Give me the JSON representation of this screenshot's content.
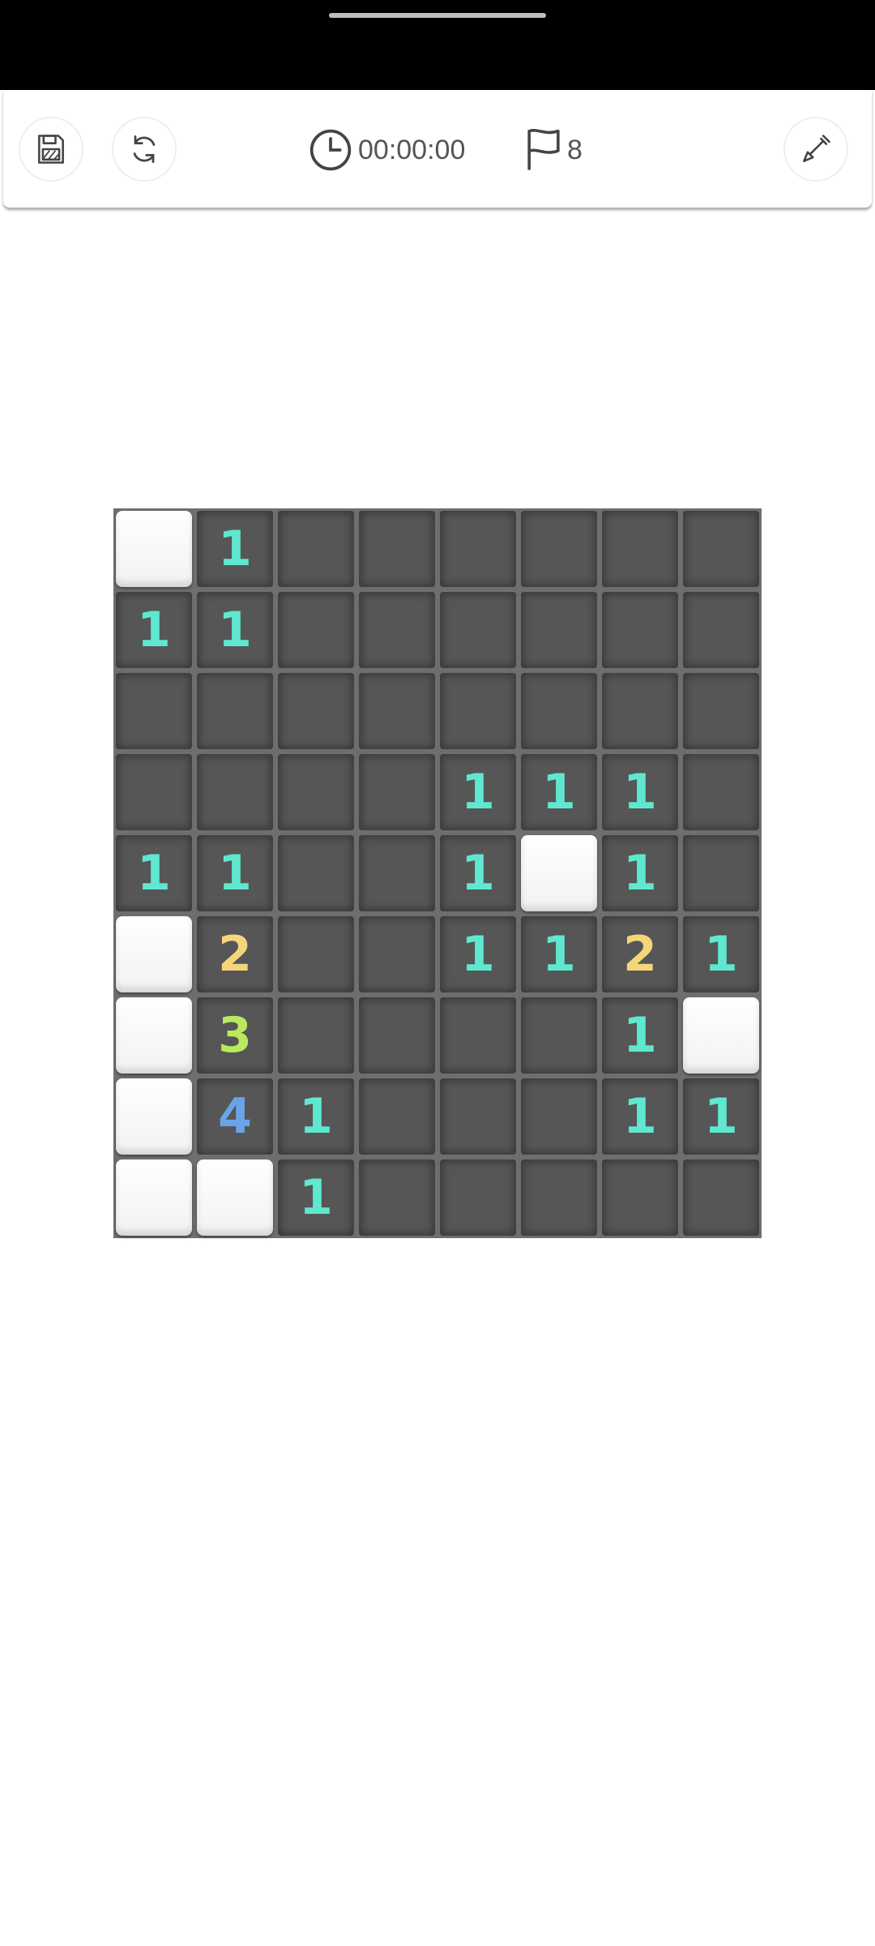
{
  "toolbar": {
    "timer": "00:00:00",
    "flags": "8",
    "icons": {
      "save": "floppy-disk-icon",
      "restart": "refresh-icon",
      "timer": "clock-icon",
      "flags": "flag-icon",
      "tool": "shovel-icon"
    }
  },
  "board": {
    "rows": 9,
    "cols": 8,
    "cells": [
      [
        "H",
        "1",
        "",
        "",
        "",
        "",
        "",
        ""
      ],
      [
        "1",
        "1",
        "",
        "",
        "",
        "",
        "",
        ""
      ],
      [
        "",
        "",
        "",
        "",
        "",
        "",
        "",
        ""
      ],
      [
        "",
        "",
        "",
        "",
        "1",
        "1",
        "1",
        ""
      ],
      [
        "1",
        "1",
        "",
        "",
        "1",
        "H",
        "1",
        ""
      ],
      [
        "H",
        "2",
        "",
        "",
        "1",
        "1",
        "2",
        "1"
      ],
      [
        "H",
        "3",
        "",
        "",
        "",
        "",
        "1",
        "H"
      ],
      [
        "H",
        "4",
        "1",
        "",
        "",
        "",
        "1",
        "1"
      ],
      [
        "H",
        "H",
        "1",
        "",
        "",
        "",
        "",
        ""
      ]
    ]
  },
  "colors": {
    "1": "#5fe8cf",
    "2": "#f5d57a",
    "3": "#b9ea5e",
    "4": "#6aa4e8",
    "revealed": "#565656",
    "hidden": "#ffffff",
    "board_frame": "#6e6e6e"
  }
}
